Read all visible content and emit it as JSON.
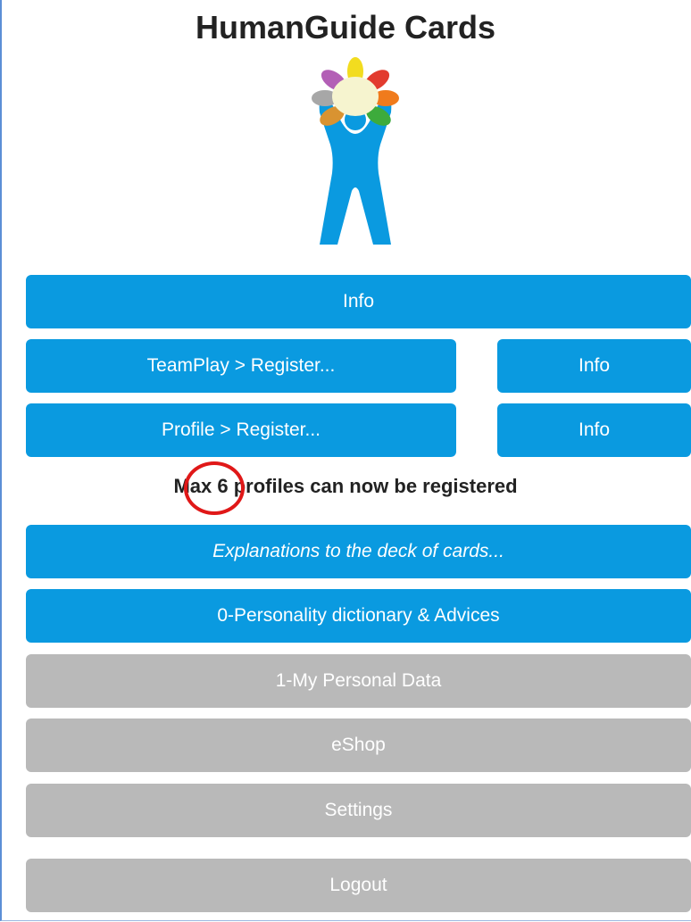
{
  "app": {
    "title": "HumanGuide Cards"
  },
  "logo": {
    "icon": "humanguide-logo-icon"
  },
  "buttons": {
    "info_main": "Info",
    "teamplay_register": "TeamPlay > Register...",
    "teamplay_info": "Info",
    "profile_register": "Profile > Register...",
    "profile_info": "Info",
    "explanations": "Explanations to the deck of cards...",
    "dictionary": "0-Personality dictionary & Advices",
    "personal_data": "1-My Personal Data",
    "eshop": "eShop",
    "settings": "Settings",
    "logout": "Logout"
  },
  "notice": {
    "text": "Max 6 profiles can now be registered"
  },
  "colors": {
    "primary": "#0a9ae0",
    "disabled": "#b9b9b9",
    "highlight_circle": "#e01818"
  }
}
